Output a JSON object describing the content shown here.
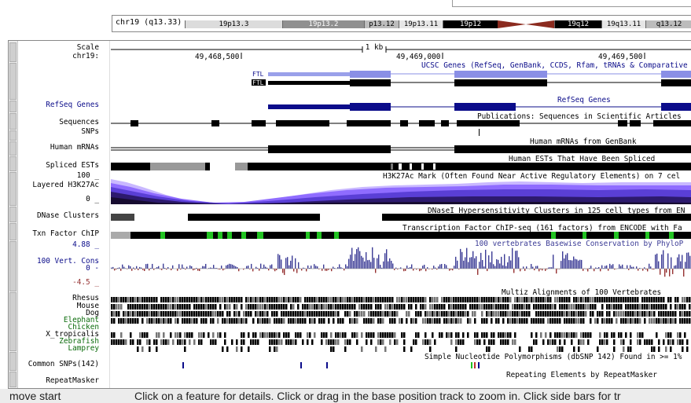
{
  "ideogram": {
    "label": "chr19 (q13.33)",
    "bands": [
      "19p13.3",
      "19p13.2",
      "p13.12",
      "19p13.11",
      "19p12",
      "19q12",
      "19q13.11",
      "q13.12"
    ]
  },
  "ruler": {
    "scale_label": "Scale",
    "chrom_label": "chr19:",
    "scale_text": "1 kb",
    "positions": [
      "49,468,500",
      "49,469,000",
      "49,469,500"
    ]
  },
  "tracks": {
    "ucsc_genes": {
      "title": "UCSC Genes (RefSeq, GenBank, CCDS, Rfam, tRNAs & Comparative",
      "gene1": "FTL",
      "gene2": "FTL"
    },
    "refseq": {
      "label": "RefSeq Genes",
      "title": "RefSeq Genes"
    },
    "sequences": {
      "label": "Sequences",
      "title": "Publications: Sequences in Scientific Articles"
    },
    "snps": {
      "label": "SNPs"
    },
    "human_mrnas": {
      "label": "Human mRNAs",
      "title": "Human mRNAs from GenBank"
    },
    "spliced_ests": {
      "label": "Spliced ESTs",
      "title": "Human ESTs That Have Been Spliced"
    },
    "h3k27ac": {
      "label": "Layered H3K27Ac",
      "max": "100 _",
      "min": "0 _",
      "title": "H3K27Ac Mark (Often Found Near Active Regulatory Elements) on 7 cel"
    },
    "dnase": {
      "label": "DNase Clusters",
      "title": "DNaseI Hypersensitivity Clusters in 125 cell types from EN"
    },
    "txn": {
      "label": "Txn Factor ChIP",
      "title": "Transcription Factor ChIP-seq (161 factors) from ENCODE with Fa"
    },
    "cons": {
      "label": "100 Vert. Cons",
      "max": "4.88 _",
      "zero": "0 -",
      "min": "-4.5 _",
      "title": "100 vertebrates Basewise Conservation by PhyloP"
    },
    "multiz": {
      "title": "Multiz Alignments of 100 Vertebrates",
      "species": [
        {
          "name": "Rhesus",
          "color": "#000000"
        },
        {
          "name": "Mouse",
          "color": "#000000"
        },
        {
          "name": "Dog",
          "color": "#000000"
        },
        {
          "name": "Elephant",
          "color": "#0a6b0a"
        },
        {
          "name": "Chicken",
          "color": "#0a6b0a"
        },
        {
          "name": "X_tropicalis",
          "color": "#000000"
        },
        {
          "name": "Zebrafish",
          "color": "#0a6b0a"
        },
        {
          "name": "Lamprey",
          "color": "#0a6b0a"
        }
      ]
    },
    "common_snps": {
      "label": "Common SNPs(142)",
      "title": "Simple Nucleotide Polymorphisms (dbSNP 142) Found in >= 1%"
    },
    "repeatmasker": {
      "label": "RepeatMasker",
      "title": "Repeating Elements by RepeatMasker"
    }
  },
  "status": {
    "left": "move start",
    "right": "Click on a feature for details. Click or drag in the base position track to zoom in. Click side bars for tr"
  },
  "colors": {
    "gene_blue": "#0b0c8a",
    "ucsc_blue": "#8a8fe6",
    "txn_green": "#22c322",
    "cons_blue": "#3c3c96",
    "cons_red": "#963232"
  }
}
